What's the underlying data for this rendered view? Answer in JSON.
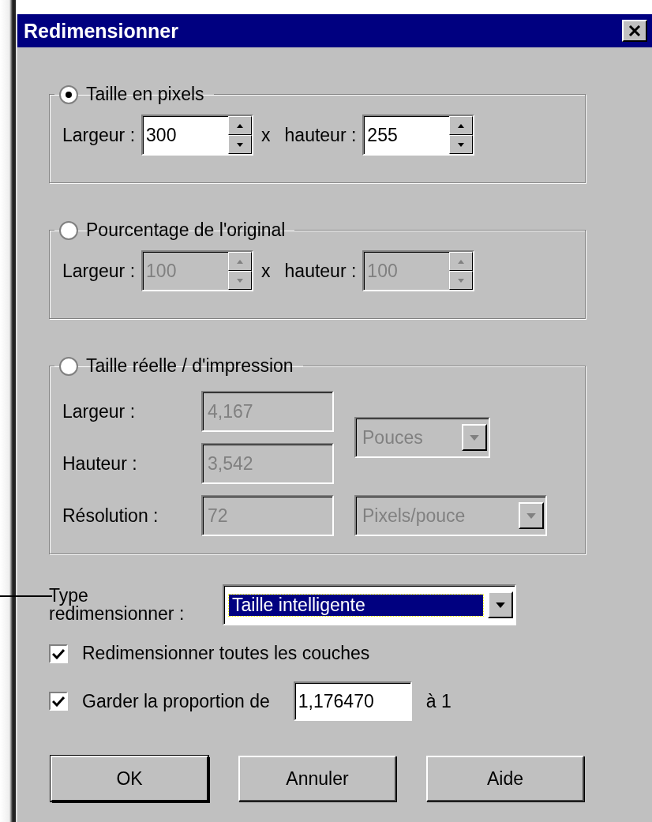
{
  "window": {
    "title": "Redimensionner"
  },
  "groups": [
    {
      "kind": "pair",
      "label": "Taille en pixels",
      "selected": true,
      "disabled": false,
      "separator": "x",
      "fields": [
        {
          "label": "Largeur :",
          "value": "300"
        },
        {
          "label": "hauteur :",
          "value": "255"
        }
      ]
    },
    {
      "kind": "pair",
      "label": "Pourcentage de l'original",
      "selected": false,
      "disabled": true,
      "separator": "x",
      "fields": [
        {
          "label": "Largeur :",
          "value": "100"
        },
        {
          "label": "hauteur :",
          "value": "100"
        }
      ]
    },
    {
      "kind": "print",
      "label": "Taille réelle / d'impression",
      "selected": false,
      "disabled": true,
      "fields": [
        {
          "label": "Largeur :",
          "value": "4,167"
        },
        {
          "label": "Hauteur :",
          "value": "3,542"
        },
        {
          "label": "Résolution :",
          "value": "72"
        }
      ],
      "units": [
        {
          "value": "Pouces"
        },
        {
          "value": "Pixels/pouce"
        }
      ]
    }
  ],
  "resample": {
    "label": "Type redimensionner :",
    "value": "Taille intelligente"
  },
  "options": [
    {
      "label": "Redimensionner toutes les couches",
      "checked": true
    },
    {
      "label": "Garder la proportion de",
      "checked": true,
      "value": "1,176470",
      "suffix": "à 1"
    }
  ],
  "buttons": [
    {
      "label": "OK",
      "default": true
    },
    {
      "label": "Annuler",
      "default": false
    },
    {
      "label": "Aide",
      "default": false
    }
  ]
}
